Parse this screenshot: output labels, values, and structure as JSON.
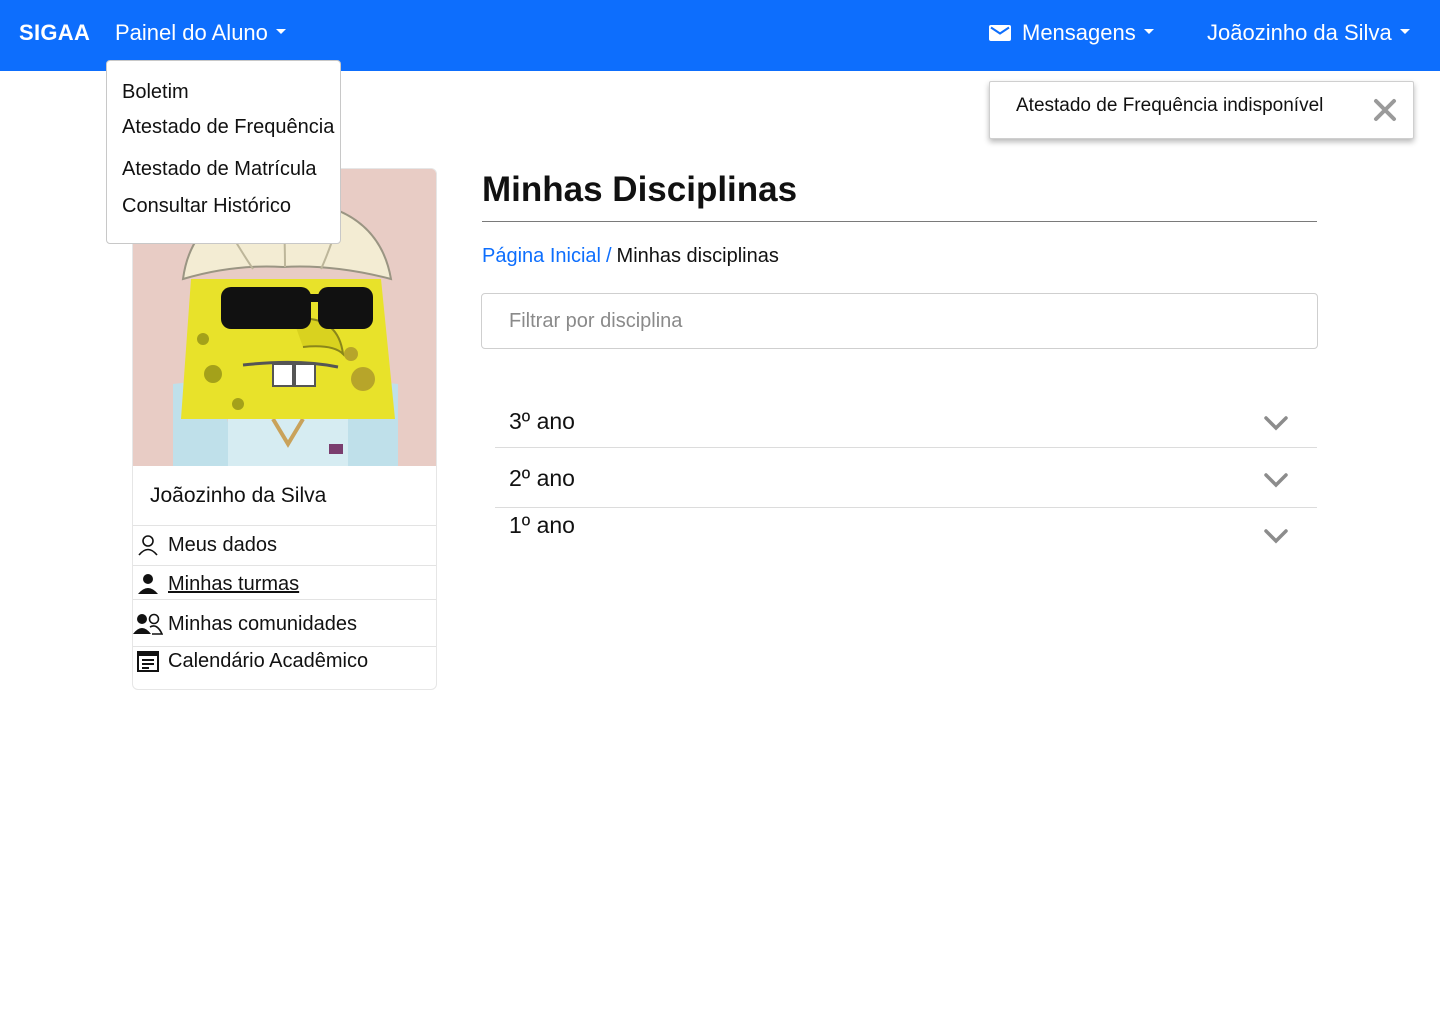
{
  "navbar": {
    "brand": "SIGAA",
    "painel_label": "Painel do Aluno",
    "messages_label": "Mensagens",
    "user_label": "Joãozinho da Silva",
    "background": "#0d6efd"
  },
  "painel_menu": {
    "items": [
      "Boletim",
      "Atestado de Frequência",
      "Atestado de Matrícula",
      "Consultar Histórico"
    ]
  },
  "toast": {
    "message": "Atestado de Frequência indisponível",
    "close_icon": "close-icon"
  },
  "profile": {
    "name": "Joãozinho da Silva",
    "menu": [
      {
        "label": "Meus dados",
        "icon": "person-outline-icon"
      },
      {
        "label": "Minhas turmas",
        "icon": "person-filled-icon"
      },
      {
        "label": "Minhas comunidades",
        "icon": "people-icon"
      },
      {
        "label": "Calendário Acadêmico",
        "icon": "calendar-icon"
      }
    ]
  },
  "main": {
    "title": "Minhas Disciplinas",
    "breadcrumb": {
      "home": "Página Inicial",
      "separator": "/",
      "current": "Minhas disciplinas"
    },
    "filter_placeholder": "Filtrar por disciplina",
    "accordion": [
      "3º ano",
      "2º ano",
      "1º ano"
    ]
  },
  "colors": {
    "accent": "#0d6efd",
    "chevron": "#8c8c8c"
  }
}
